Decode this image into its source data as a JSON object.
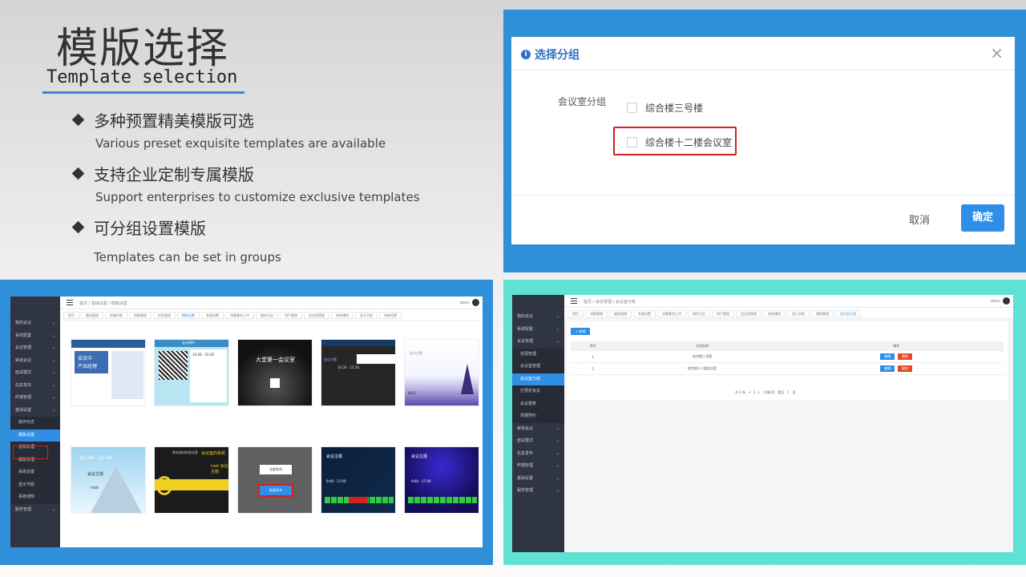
{
  "heading": {
    "title_cn": "模版选择",
    "title_en": "Template selection"
  },
  "bullets": [
    {
      "cn": "多种预置精美模版可选",
      "en": "Various preset exquisite templates are available"
    },
    {
      "cn": "支持企业定制专属模版",
      "en": "Support enterprises to customize exclusive templates"
    },
    {
      "cn": "可分组设置模版",
      "en": "Templates can be set in groups"
    }
  ],
  "dialog": {
    "title": "选择分组",
    "info_icon": "i",
    "close": "×",
    "field_label": "会议室分组",
    "options": [
      "综合楼三号楼",
      "综合楼十二楼会议室"
    ],
    "cancel_label": "取消",
    "ok_label": "确定"
  },
  "templates_ui": {
    "breadcrumb": "首页 / 基础设置 / 模板设置",
    "admin": "admin",
    "sidebar": [
      {
        "label": "我的会议",
        "type": "top"
      },
      {
        "label": "系统配置",
        "type": "top"
      },
      {
        "label": "会议管理",
        "type": "top"
      },
      {
        "label": "审批会议",
        "type": "top"
      },
      {
        "label": "面试模式",
        "type": "top"
      },
      {
        "label": "信息发布",
        "type": "top"
      },
      {
        "label": "终端管理",
        "type": "top"
      },
      {
        "label": "基础设置",
        "type": "top"
      },
      {
        "label": "操作日志",
        "type": "sub"
      },
      {
        "label": "模板设置",
        "type": "active"
      },
      {
        "label": "通知管理",
        "type": "sub"
      },
      {
        "label": "模版管理",
        "type": "sub"
      },
      {
        "label": "系统设置",
        "type": "sub"
      },
      {
        "label": "显示节假",
        "type": "sub"
      },
      {
        "label": "系统通知",
        "type": "sub"
      },
      {
        "label": "服务管理",
        "type": "top"
      }
    ],
    "tabs": [
      "首页",
      "服务管理",
      "终端列表",
      "场景管理",
      "信息管理",
      "模板设置",
      "系统设置",
      "场景素材上传",
      "操作日志",
      "用户管理",
      "会议室管理",
      "系统通知",
      "显示节假",
      "系统设置"
    ],
    "templates": [
      {
        "t1": "会议中",
        "t2": "产品经理",
        "t3": ""
      },
      {
        "t1": "会议预约",
        "t2": "10:26 - 15:26",
        "t3": ""
      },
      {
        "t1": "大堂第一会议室",
        "t2": "",
        "t3": ""
      },
      {
        "t1": "会议主题",
        "t2": "10:26 - 15:26",
        "t3": ""
      },
      {
        "t1": "会议主题",
        "t2": "NEXT",
        "t3": ""
      },
      {
        "t1": "10:26 - 15:26",
        "t2": "会议主题",
        "t3": "root"
      },
      {
        "t1": "周末测试的会议室",
        "t2": "会议室的系统",
        "t3": "root 会议主题"
      },
      {
        "t1": "全屏发布",
        "t2": "批量发布",
        "t3": ""
      },
      {
        "t1": "会议主题",
        "t2": "9:00 - 17:00",
        "t3": ""
      },
      {
        "t1": "会议主题",
        "t2": "9:00 - 17:00",
        "t3": ""
      }
    ]
  },
  "rooms_ui": {
    "breadcrumb": "首页 / 会议管理 / 会议室分组",
    "admin": "admin",
    "add_button": "+ 新增",
    "sidebar": [
      {
        "label": "我的会议",
        "type": "top"
      },
      {
        "label": "系统配置",
        "type": "top"
      },
      {
        "label": "会议管理",
        "type": "top"
      },
      {
        "label": "资源管理",
        "type": "sub"
      },
      {
        "label": "会议室管理",
        "type": "sub"
      },
      {
        "label": "会议室分组",
        "type": "active"
      },
      {
        "label": "已预定会议",
        "type": "sub"
      },
      {
        "label": "会议报表",
        "type": "sub"
      },
      {
        "label": "周期预约",
        "type": "sub"
      },
      {
        "label": "审批会议",
        "type": "top"
      },
      {
        "label": "面试模式",
        "type": "top"
      },
      {
        "label": "信息发布",
        "type": "top"
      },
      {
        "label": "终端管理",
        "type": "top"
      },
      {
        "label": "基础设置",
        "type": "top"
      },
      {
        "label": "服务管理",
        "type": "top"
      }
    ],
    "tabs": [
      "首页",
      "场景管理",
      "服务管理",
      "系统设置",
      "场景素材上传",
      "操作日志",
      "用户管理",
      "会议室管理",
      "系统通知",
      "显示节假",
      "通知管理",
      "会议室分组"
    ],
    "columns": [
      "序号",
      "分组名称",
      "操作"
    ],
    "rows": [
      {
        "no": "1",
        "name": "综合楼三号楼"
      },
      {
        "no": "2",
        "name": "综合楼十二楼会议室"
      }
    ],
    "edit_label": "编辑",
    "delete_label": "删除",
    "pagination": "共 2 条   <  1  >   10条/页   跳至   1   页"
  },
  "colors": {
    "accent": "#2f8fe8",
    "panel_blue": "#2f8fd8",
    "panel_teal": "#5fe2d3",
    "highlight": "#d42020",
    "sidebar": "#2f3542"
  }
}
